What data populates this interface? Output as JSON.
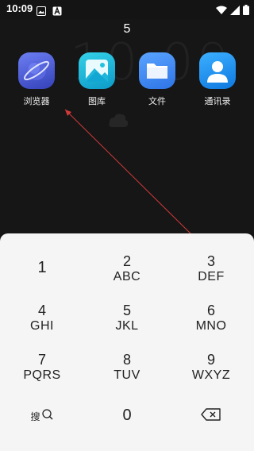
{
  "status_bar": {
    "time": "10:09",
    "icons": [
      "image-icon",
      "text-a-icon",
      "wifi-icon",
      "signal-icon",
      "battery-icon"
    ]
  },
  "search": {
    "typed_digits": "5"
  },
  "apps": [
    {
      "name": "browser",
      "label": "浏览器",
      "icon": "planet-icon",
      "color": "#4d5fd8"
    },
    {
      "name": "gallery",
      "label": "图库",
      "icon": "landscape-icon",
      "color": "#12b4d8"
    },
    {
      "name": "files",
      "label": "文件",
      "icon": "folder-icon",
      "color": "#3f8cf0"
    },
    {
      "name": "contacts",
      "label": "通讯录",
      "icon": "person-icon",
      "color": "#1a8ff0"
    }
  ],
  "keypad": {
    "keys": [
      {
        "digit": "1",
        "letters": ""
      },
      {
        "digit": "2",
        "letters": "ABC"
      },
      {
        "digit": "3",
        "letters": "DEF"
      },
      {
        "digit": "4",
        "letters": "GHI"
      },
      {
        "digit": "5",
        "letters": "JKL"
      },
      {
        "digit": "6",
        "letters": "MNO"
      },
      {
        "digit": "7",
        "letters": "PQRS"
      },
      {
        "digit": "8",
        "letters": "TUV"
      },
      {
        "digit": "9",
        "letters": "WXYZ"
      }
    ],
    "search_key": "搜",
    "zero": "0",
    "backspace_icon": "backspace-icon"
  }
}
